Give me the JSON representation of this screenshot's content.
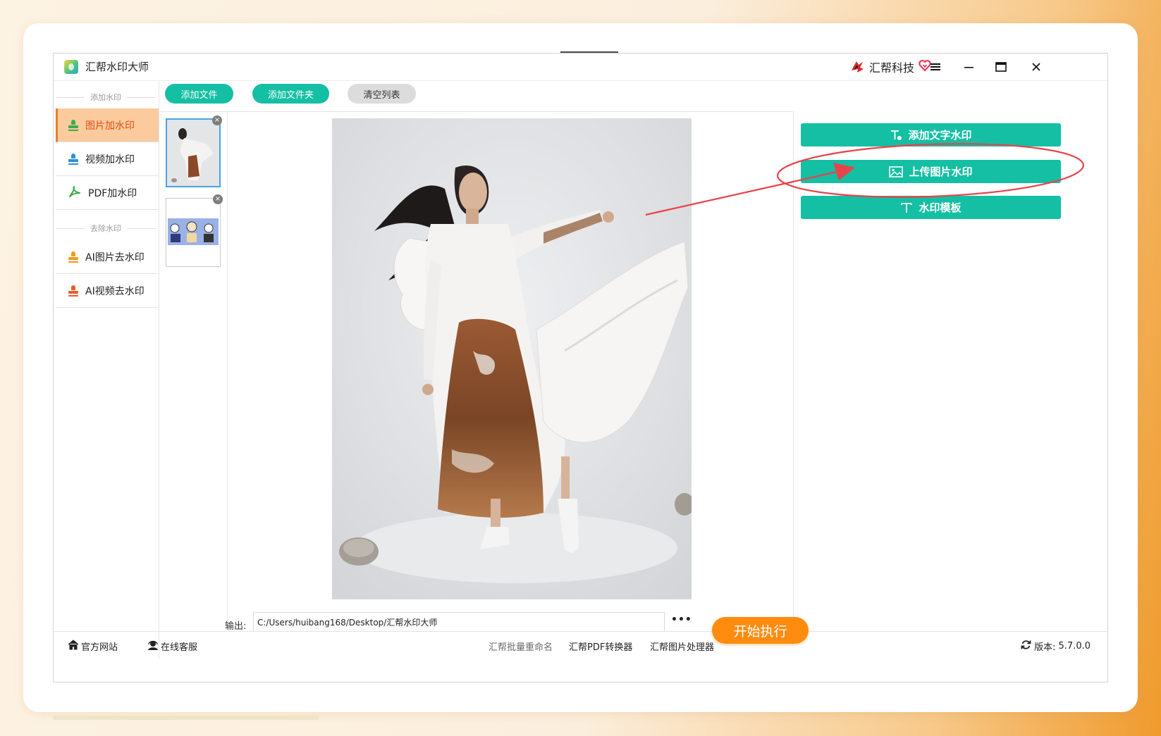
{
  "window": {
    "title": "汇帮水印大师",
    "brand": "汇帮科技"
  },
  "sidebar": {
    "section_add": "添加水印",
    "section_remove": "去除水印",
    "items": [
      {
        "label": "图片加水印"
      },
      {
        "label": "视频加水印"
      },
      {
        "label": "PDF加水印"
      },
      {
        "label": "AI图片去水印"
      },
      {
        "label": "AI视频去水印"
      }
    ]
  },
  "toolbar": {
    "add_file": "添加文件",
    "add_folder": "添加文件夹",
    "clear_list": "清空列表"
  },
  "thumbnails": {
    "close_glyph": "×"
  },
  "right_panel": {
    "add_text_watermark": "添加文字水印",
    "upload_image_watermark": "上传图片水印",
    "watermark_template": "水印模板"
  },
  "output": {
    "label": "输出:",
    "path": "C:/Users/huibang168/Desktop/汇帮水印大师",
    "more": "•••",
    "start": "开始执行"
  },
  "statusbar": {
    "website": "官方网站",
    "support": "在线客服",
    "rename": "汇帮批量重命名",
    "pdf_converter": "汇帮PDF转换器",
    "image_processor": "汇帮图片处理器",
    "version_label": "版本:",
    "version": "5.7.0.0"
  },
  "colors": {
    "accent_green": "#14bfa3",
    "accent_orange": "#ff8c0f",
    "active_item_bg": "#fbcb9d",
    "annotation_red": "#e8424a"
  },
  "icons": [
    "app-logo",
    "brand-logo-icon",
    "heart-icon",
    "menu-icon",
    "minimize-icon",
    "maximize-icon",
    "close-icon",
    "stamp-icon",
    "pdf-icon",
    "text-icon",
    "image-icon",
    "home-icon",
    "headset-icon",
    "refresh-icon"
  ]
}
